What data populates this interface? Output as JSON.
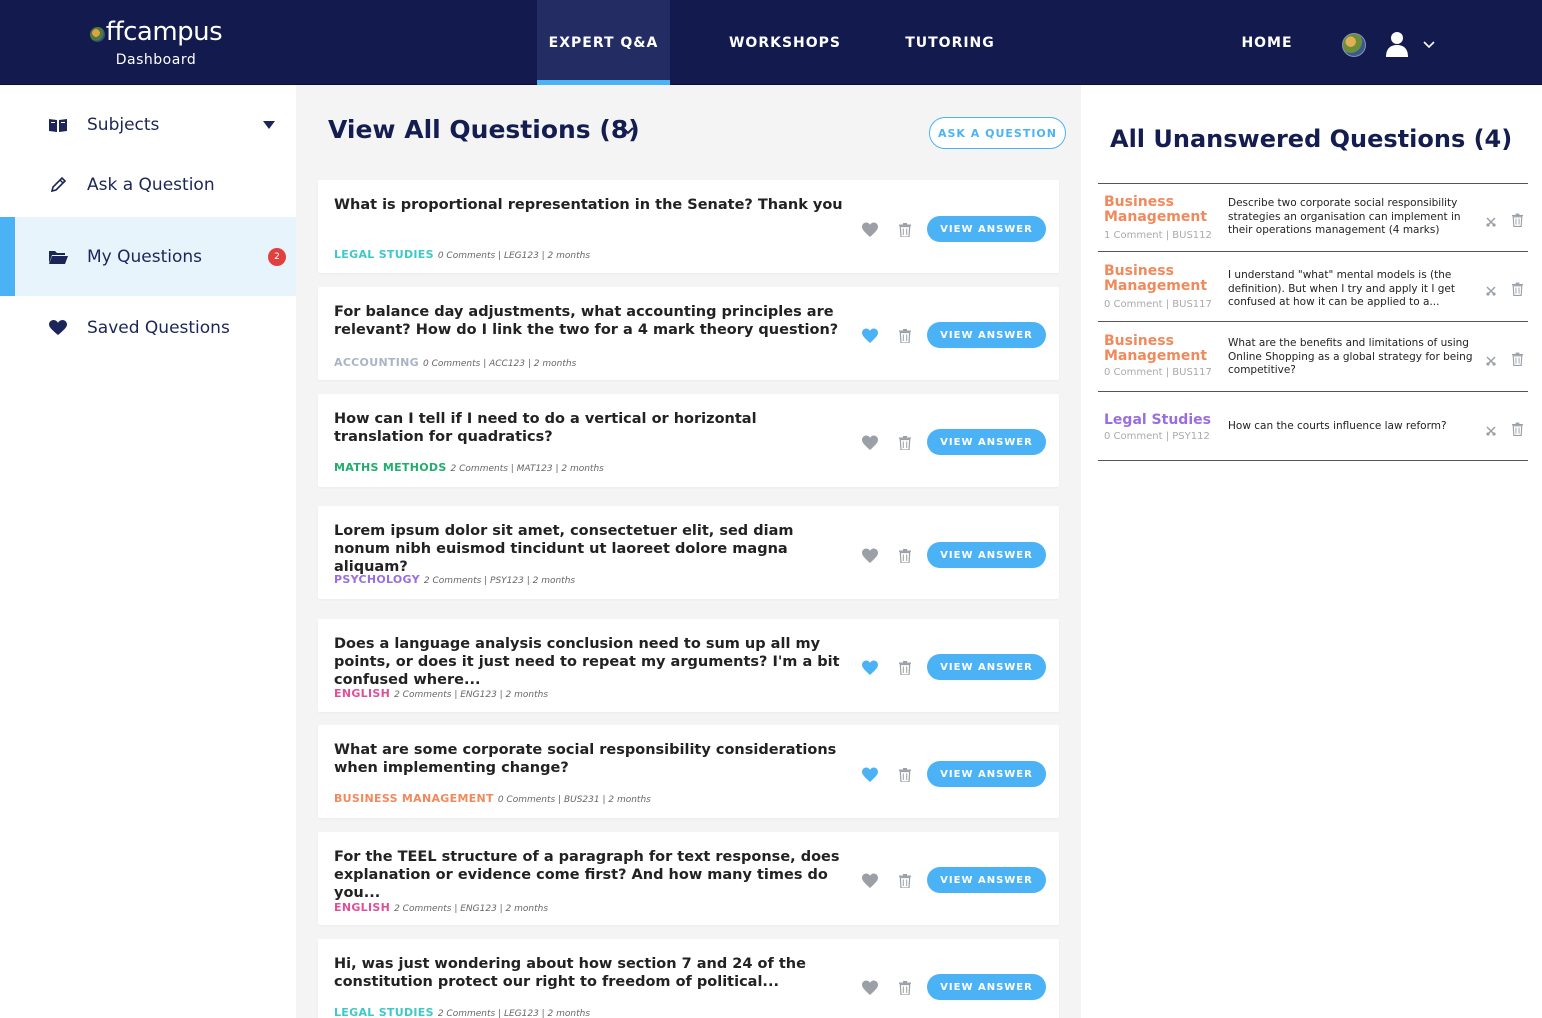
{
  "brand": {
    "name": "ffcampus",
    "subtitle": "Dashboard"
  },
  "nav": {
    "items": [
      {
        "label": "EXPERT Q&A",
        "active": true
      },
      {
        "label": "WORKSHOPS",
        "active": false
      },
      {
        "label": "TUTORING",
        "active": false
      }
    ],
    "home": "HOME"
  },
  "sidebar": {
    "items": [
      {
        "label": "Subjects",
        "icon": "book-icon"
      },
      {
        "label": "Ask a Question",
        "icon": "pencil-icon"
      },
      {
        "label": "My Questions",
        "icon": "folder-icon",
        "badge": "2",
        "active": true
      },
      {
        "label": "Saved Questions",
        "icon": "heart-icon"
      }
    ]
  },
  "main": {
    "title": "View All Questions (8)",
    "ask_button": "ASK A QUESTION",
    "view_answer": "VIEW ANSWER",
    "questions": [
      {
        "text": "What is proportional representation in the Senate? Thank you",
        "subject": "LEGAL STUDIES",
        "subject_color": "#3ec8c8",
        "info": "0 Comments | LEG123 | 2 months",
        "liked": false
      },
      {
        "text": "For balance day adjustments, what accounting principles are relevant? How do I link the two for a 4 mark theory question?",
        "subject": "ACCOUNTING",
        "subject_color": "#a9b4c7",
        "info": "0 Comments | ACC123 | 2 months",
        "liked": true
      },
      {
        "text": "How can I tell if I need to do a vertical or horizontal translation for quadratics?",
        "subject": "MATHS METHODS",
        "subject_color": "#1fae6b",
        "info": "2 Comments | MAT123 | 2 months",
        "liked": false
      },
      {
        "text": "Lorem ipsum dolor sit amet, consectetuer elit, sed diam nonum nibh euismod tincidunt ut laoreet dolore magna aliquam?",
        "subject": "PSYCHOLOGY",
        "subject_color": "#9a6ee0",
        "info": "2 Comments | PSY123 | 2 months",
        "liked": false
      },
      {
        "text": "Does a language analysis conclusion need to sum up all my points, or does it just need to repeat my arguments? I'm a bit confused where...",
        "subject": "ENGLISH",
        "subject_color": "#e0509a",
        "info": "2 Comments | ENG123 | 2 months",
        "liked": true
      },
      {
        "text": "What are some corporate social responsibility considerations when implementing change?",
        "subject": "BUSINESS MANAGEMENT",
        "subject_color": "#f08a5d",
        "info": "0 Comments | BUS231 | 2 months",
        "liked": true
      },
      {
        "text": "For the TEEL structure of a paragraph for text response, does explanation or evidence come first? And how many times do you...",
        "subject": "ENGLISH",
        "subject_color": "#e0509a",
        "info": "2 Comments | ENG123 | 2 months",
        "liked": false
      },
      {
        "text": "Hi, was just wondering about how section 7 and 24 of the constitution protect our right to freedom of political...",
        "subject": "LEGAL STUDIES",
        "subject_color": "#3ec8c8",
        "info": "2 Comments | LEG123 | 2 months",
        "liked": false
      }
    ]
  },
  "unanswered": {
    "title": "All Unanswered Questions (4)",
    "items": [
      {
        "subject": "Business Management",
        "subject_color": "#f08a5d",
        "meta": "1 Comment | BUS112",
        "text": "Describe two corporate social responsibility strategies an organisation can implement in their operations management (4 marks)"
      },
      {
        "subject": "Business Management",
        "subject_color": "#f08a5d",
        "meta": "0 Comment | BUS117",
        "text": "I understand \"what\" mental models is (the definition). But when I try and apply it I get confused at how it can be applied to a..."
      },
      {
        "subject": "Business Management",
        "subject_color": "#f08a5d",
        "meta": "0 Comment | BUS117",
        "text": "What are the benefits and limitations of using Online Shopping as a global strategy for being competitive?"
      },
      {
        "subject": "Legal Studies",
        "subject_color": "#9a6ee0",
        "meta": "0 Comment | PSY112",
        "text": "How can the courts influence law reform?"
      }
    ]
  },
  "colors": {
    "navy": "#131a4d",
    "accent": "#4bb3f5",
    "heart_inactive": "#9aa0a6",
    "badge": "#e2403e"
  }
}
